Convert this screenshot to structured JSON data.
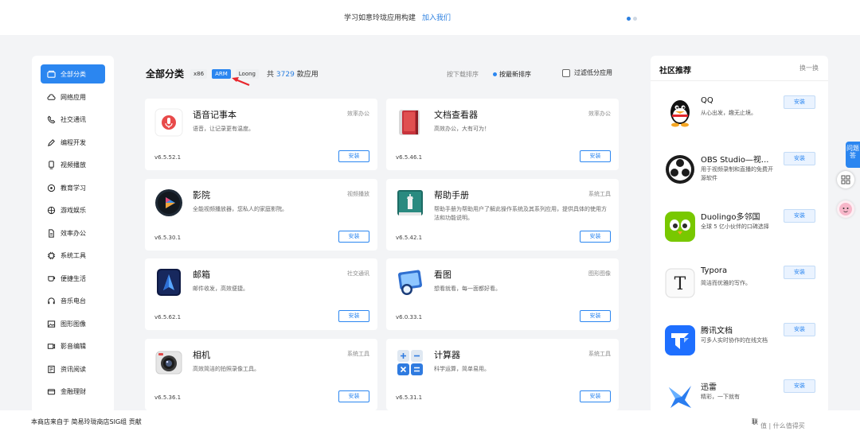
{
  "banner": {
    "text": "学习如意玲珑应用构建",
    "link": "加入我们",
    "dots": 2
  },
  "sidebar": {
    "items": [
      {
        "label": "全部分类",
        "icon": "all-categories-icon",
        "active": true
      },
      {
        "label": "网络应用",
        "icon": "cloud-icon"
      },
      {
        "label": "社交通讯",
        "icon": "phone-icon"
      },
      {
        "label": "编程开发",
        "icon": "pen-icon"
      },
      {
        "label": "视频播放",
        "icon": "video-icon"
      },
      {
        "label": "教育学习",
        "icon": "education-icon"
      },
      {
        "label": "游戏娱乐",
        "icon": "game-icon"
      },
      {
        "label": "效率办公",
        "icon": "document-icon"
      },
      {
        "label": "系统工具",
        "icon": "chip-icon"
      },
      {
        "label": "便捷生活",
        "icon": "cup-icon"
      },
      {
        "label": "音乐电台",
        "icon": "headphones-icon"
      },
      {
        "label": "图形图像",
        "icon": "image-icon"
      },
      {
        "label": "影音编辑",
        "icon": "camera-icon"
      },
      {
        "label": "资讯阅读",
        "icon": "news-icon"
      },
      {
        "label": "金融理财",
        "icon": "wallet-icon"
      }
    ]
  },
  "main": {
    "title": "全部分类",
    "arch_tags": [
      "x86",
      "ARM",
      "Loong"
    ],
    "active_arch": "ARM",
    "count_prefix": "共",
    "count": "3729",
    "count_suffix": "款应用",
    "sort_download": "按下载排序",
    "sort_new": "按最新排序",
    "filter_label": "过滤低分应用"
  },
  "apps": [
    {
      "name": "语音记事本",
      "desc": "语音，让记录更有温度。",
      "category": "效率办公",
      "version": "v6.5.52.1",
      "install": "安装",
      "icon": "voice-note-icon"
    },
    {
      "name": "文档查看器",
      "desc": "高效办公，大有可为！",
      "category": "效率办公",
      "version": "v6.5.46.1",
      "install": "安装",
      "icon": "document-viewer-icon"
    },
    {
      "name": "影院",
      "desc": "全能视频播放器，您私人的家庭影院。",
      "category": "视频播放",
      "version": "v6.5.30.1",
      "install": "安装",
      "icon": "movie-icon"
    },
    {
      "name": "帮助手册",
      "desc": "帮助手册为帮助用户了解此操作系统及其系列应用，提供具体的使用方法和功能说明。",
      "category": "系统工具",
      "version": "v6.5.42.1",
      "install": "安装",
      "icon": "help-manual-icon"
    },
    {
      "name": "邮箱",
      "desc": "邮件收发，高效便捷。",
      "category": "社交通讯",
      "version": "v6.5.62.1",
      "install": "安装",
      "icon": "mail-icon"
    },
    {
      "name": "看图",
      "desc": "想看就看，每一面都好看。",
      "category": "图形图像",
      "version": "v6.0.33.1",
      "install": "安装",
      "icon": "image-viewer-icon"
    },
    {
      "name": "相机",
      "desc": "高效简洁的拍照录像工具。",
      "category": "系统工具",
      "version": "v6.5.36.1",
      "install": "安装",
      "icon": "camera-app-icon"
    },
    {
      "name": "计算器",
      "desc": "科学运算，简单易用。",
      "category": "系统工具",
      "version": "v6.5.31.1",
      "install": "安装",
      "icon": "calculator-icon"
    }
  ],
  "community": {
    "title": "社区推荐",
    "refresh": "换一换",
    "items": [
      {
        "name": "QQ",
        "desc": "从心出发，趣无止境。",
        "install": "安装",
        "icon": "qq-icon"
      },
      {
        "name": "OBS Studio—视...",
        "desc": "用于视频录制和直播的免费开源软件",
        "install": "安装",
        "icon": "obs-icon"
      },
      {
        "name": "Duolingo多邻国",
        "desc": "全球 5 亿小伙伴的口碑选择",
        "install": "安装",
        "icon": "duolingo-icon"
      },
      {
        "name": "Typora",
        "desc": "简洁而优雅的写作。",
        "install": "安装",
        "icon": "typora-icon"
      },
      {
        "name": "腾讯文档",
        "desc": "可多人实时协作的在线文档",
        "install": "安装",
        "icon": "tencent-docs-icon"
      },
      {
        "name": "迅雷",
        "desc": "精彩，一下就有",
        "install": "安装",
        "icon": "xunlei-icon"
      }
    ]
  },
  "float": {
    "tab_label": "问题答"
  },
  "footer": {
    "text": "本商店来自于 简易玲珑商店SIG组 贡献",
    "right": "联",
    "watermark": "值 | 什么值得买"
  },
  "colors": {
    "accent": "#2b86f0",
    "link": "#2b7fe0",
    "background": "#f3f4f6"
  }
}
